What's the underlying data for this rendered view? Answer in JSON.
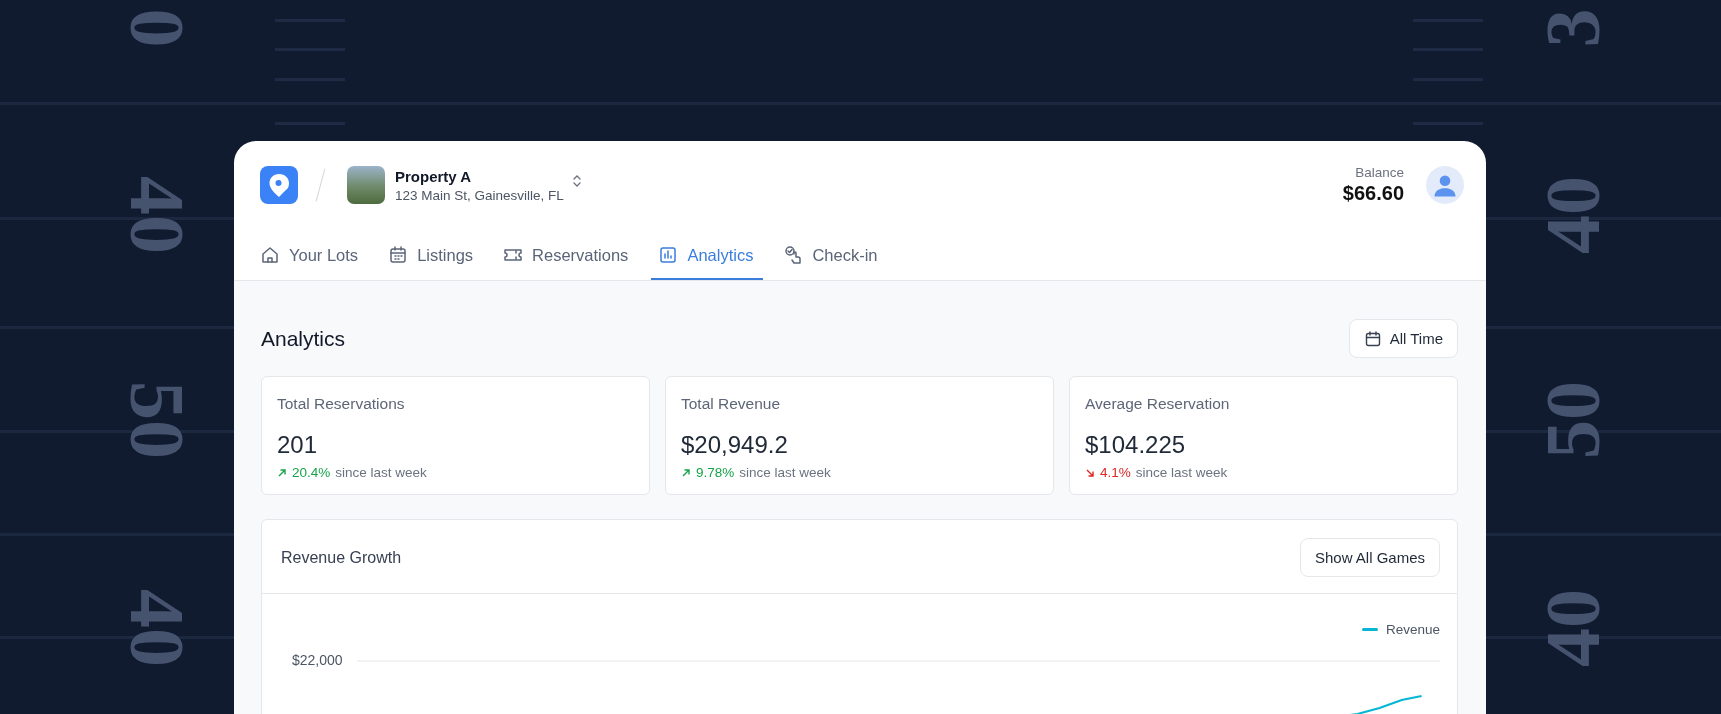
{
  "field": {
    "left_numbers": [
      "0",
      "40",
      "50",
      "40"
    ],
    "right_numbers": [
      "3",
      "40",
      "50",
      "40"
    ]
  },
  "header": {
    "property": {
      "name": "Property A",
      "address": "123 Main St, Gainesville, FL"
    },
    "balance": {
      "label": "Balance",
      "amount": "$66.60"
    }
  },
  "tabs": [
    {
      "label": "Your Lots",
      "kind": "home",
      "selected": false
    },
    {
      "label": "Listings",
      "kind": "calendar",
      "selected": false
    },
    {
      "label": "Reservations",
      "kind": "ticket",
      "selected": false
    },
    {
      "label": "Analytics",
      "kind": "chart",
      "selected": true
    },
    {
      "label": "Check-in",
      "kind": "tap",
      "selected": false
    }
  ],
  "page": {
    "title": "Analytics",
    "range_button": "All Time"
  },
  "stats": [
    {
      "label": "Total Reservations",
      "value": "201",
      "change": "20.4%",
      "rising": true,
      "note": "since last week"
    },
    {
      "label": "Total Revenue",
      "value": "$20,949.2",
      "change": "9.78%",
      "rising": true,
      "note": "since last week"
    },
    {
      "label": "Average Reservation",
      "value": "$104.225",
      "change": "4.1%",
      "rising": false,
      "note": "since last week"
    }
  ],
  "chart_card": {
    "title": "Revenue Growth",
    "button": "Show All Games",
    "legend": "Revenue",
    "y_tick": "$22,000"
  }
}
